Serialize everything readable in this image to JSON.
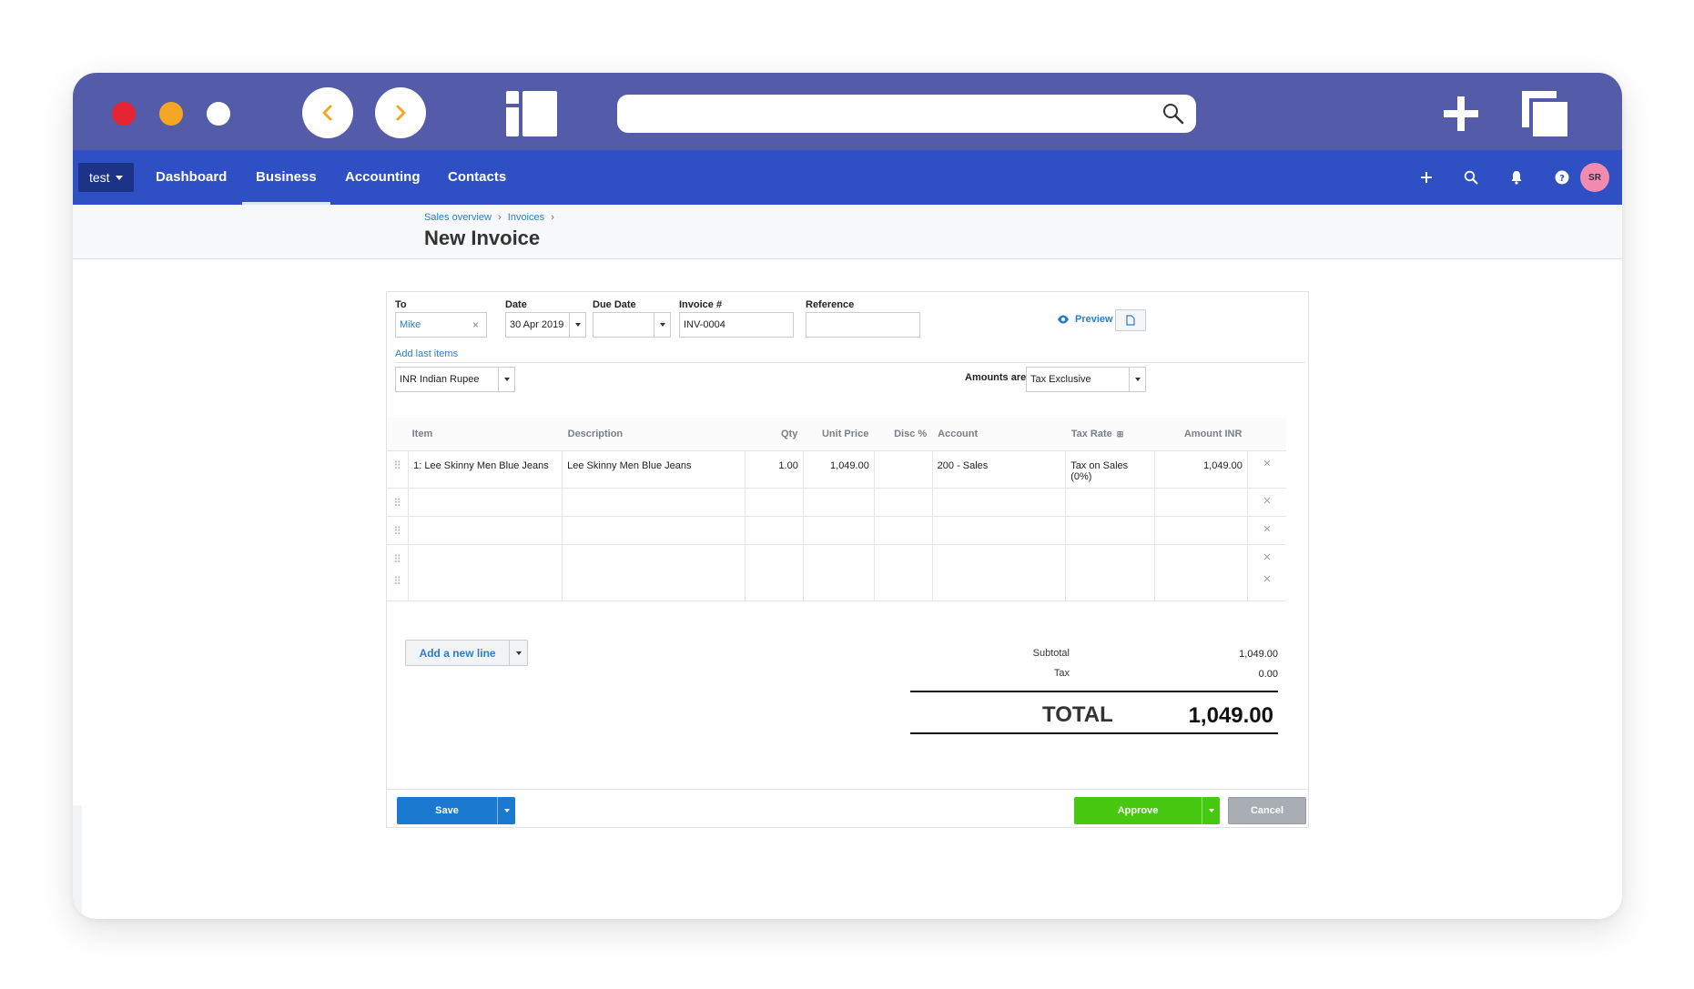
{
  "browser": {
    "traffic_lights": [
      "close",
      "minimize",
      "zoom"
    ],
    "address_value": ""
  },
  "appnav": {
    "org": "test",
    "items": [
      "Dashboard",
      "Business",
      "Accounting",
      "Contacts"
    ],
    "active": "Business",
    "avatar": "SR"
  },
  "page": {
    "breadcrumb": [
      "Sales overview",
      "Invoices"
    ],
    "title": "New Invoice"
  },
  "form": {
    "to_label": "To",
    "to_value": "Mike",
    "date_label": "Date",
    "date_value": "30 Apr 2019",
    "due_label": "Due Date",
    "due_value": "",
    "invoice_label": "Invoice #",
    "invoice_value": "INV-0004",
    "reference_label": "Reference",
    "reference_value": "",
    "preview": "Preview",
    "add_last_items": "Add last items",
    "currency": "INR Indian Rupee",
    "amounts_are_label": "Amounts are",
    "amounts_are_value": "Tax Exclusive"
  },
  "table": {
    "headers": [
      "Item",
      "Description",
      "Qty",
      "Unit Price",
      "Disc %",
      "Account",
      "Tax Rate",
      "Amount INR"
    ],
    "rows": [
      {
        "item": "1: Lee Skinny Men Blue Jeans",
        "description": "Lee Skinny Men Blue Jeans",
        "qty": "1.00",
        "unit_price": "1,049.00",
        "disc": "",
        "account": "200 - Sales",
        "tax_rate": "Tax on Sales (0%)",
        "amount": "1,049.00"
      },
      {
        "item": "",
        "description": "",
        "qty": "",
        "unit_price": "",
        "disc": "",
        "account": "",
        "tax_rate": "",
        "amount": ""
      },
      {
        "item": "",
        "description": "",
        "qty": "",
        "unit_price": "",
        "disc": "",
        "account": "",
        "tax_rate": "",
        "amount": ""
      },
      {
        "item": "",
        "description": "",
        "qty": "",
        "unit_price": "",
        "disc": "",
        "account": "",
        "tax_rate": "",
        "amount": ""
      }
    ],
    "add_line": "Add a new line"
  },
  "totals": {
    "subtotal_label": "Subtotal",
    "subtotal": "1,049.00",
    "tax_label": "Tax",
    "tax": "0.00",
    "total_label": "TOTAL",
    "total": "1,049.00"
  },
  "actions": {
    "save": "Save",
    "approve": "Approve",
    "cancel": "Cancel"
  },
  "colors": {
    "chrome": "#545ca9",
    "nav": "#2f4fc4",
    "link": "#2a7dc9",
    "save": "#1b79d0",
    "approve": "#46c910",
    "cancel": "#a8aeb3"
  }
}
